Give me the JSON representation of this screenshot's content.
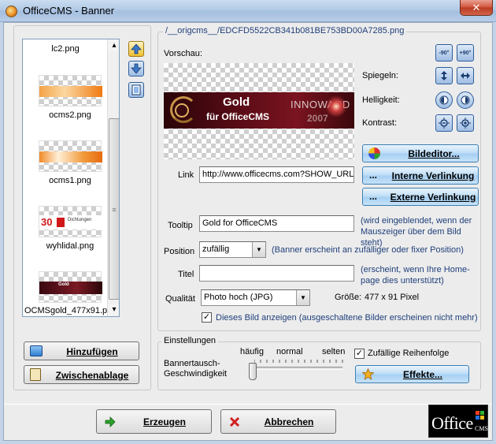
{
  "window": {
    "title": "OfficeCMS - Banner",
    "close_glyph": "✕"
  },
  "image_list": {
    "items": [
      {
        "caption": "lc2.png",
        "thumb": "blank"
      },
      {
        "caption": "ocms2.png",
        "thumb": "orange"
      },
      {
        "caption": "ocms1.png",
        "thumb": "orange"
      },
      {
        "caption": "wyhlidal.png",
        "thumb": "red-logo",
        "logo_text": "30",
        "logo_sub": "Dichtungen"
      },
      {
        "caption": "OCMSgold_477x91.p",
        "thumb": "gold"
      }
    ],
    "scroll_arrow_up": "▴",
    "scroll_arrow_down": "▾",
    "scroll_grip": "≡"
  },
  "list_tools": {
    "up_icon": "arrow-up",
    "down_icon": "arrow-down",
    "view_icon": "page"
  },
  "left_buttons": {
    "add_label": "Hinzufügen",
    "clipboard_label": "Zwischenablage"
  },
  "preview": {
    "path": "/__origcms__/EDCFD5522CB341b081BE753BD00A7285.png",
    "label": "Vorschau:",
    "banner_line1": "Gold",
    "banner_line2": "für OfficeCMS",
    "banner_brand": "INNOWARD",
    "banner_year": "2007"
  },
  "image_tools": {
    "rotate_left": "-90°",
    "rotate_right": "+90°",
    "mirror_label": "Spiegeln:",
    "brightness_label": "Helligkeit:",
    "contrast_label": "Kontrast:",
    "image_editor_label": "Bildeditor...",
    "internal_link_label": "Interne Verlinkung",
    "external_link_label": "Externe Verlinkung",
    "dots": "..."
  },
  "form": {
    "link_label": "Link",
    "link_value": "http://www.officecms.com?SHOW_URL",
    "tooltip_label": "Tooltip",
    "tooltip_value": "Gold for OfficeCMS",
    "tooltip_hint": "(wird eingeblendet, wenn der Mauszeiger über dem Bild steht)",
    "position_label": "Position",
    "position_value": "zufällig",
    "position_hint": "(Banner erscheint an zufälliger oder fixer Position)",
    "title_label": "Titel",
    "title_value": "",
    "title_hint": "(erscheint, wenn Ihre Home-page dies unterstützt)",
    "quality_label": "Qualität",
    "quality_value": "Photo hoch (JPG)",
    "size_label": "Größe:",
    "size_value": "477 x 91 Pixel",
    "show_image_label": "Dieses Bild anzeigen (ausgeschaltene Bilder erscheinen nicht mehr)",
    "show_image_checked": true
  },
  "settings": {
    "group_label": "Einstellungen",
    "speed_label": "Bannertausch-Geschwindigkeit",
    "speed_high": "häufig",
    "speed_normal": "normal",
    "speed_low": "selten",
    "speed_level": 0,
    "random_label": "Zufällige Reihenfolge",
    "random_checked": true,
    "effects_label": "Effekte..."
  },
  "footer": {
    "create_label": "Erzeugen",
    "cancel_label": "Abbrechen",
    "logo_text": "Office",
    "logo_sub": "CMS"
  },
  "colors": {
    "link_text": "#1f3f7a",
    "accent_orange": "#f08a1a",
    "banner_dark": "#4a0a12"
  }
}
